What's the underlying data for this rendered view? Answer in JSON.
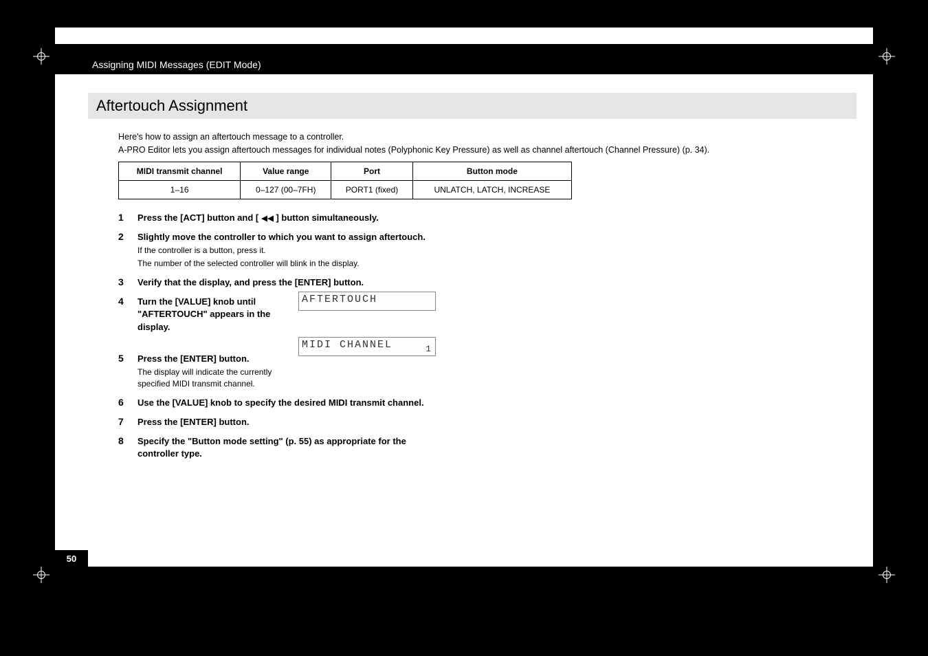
{
  "header": {
    "chapter_title": "Assigning MIDI Messages (EDIT Mode)"
  },
  "section": {
    "title": "Aftertouch Assignment"
  },
  "intro": {
    "line1": "Here's how to assign an aftertouch message to a controller.",
    "line2": "A-PRO Editor lets you assign aftertouch messages for individual notes (Polyphonic Key Pressure) as well as channel aftertouch (Channel Pressure) (p. 34)."
  },
  "table": {
    "headers": {
      "c1": "MIDI transmit channel",
      "c2": "Value range",
      "c3": "Port",
      "c4": "Button mode"
    },
    "row": {
      "c1": "1–16",
      "c2": "0–127 (00–7FH)",
      "c3": "PORT1 (fixed)",
      "c4": "UNLATCH, LATCH, INCREASE"
    }
  },
  "steps": {
    "s1": {
      "num": "1",
      "title_a": "Press the [ACT] button and [",
      "title_b": "] button simultaneously."
    },
    "s2": {
      "num": "2",
      "title": "Slightly move the controller to which you want to assign aftertouch.",
      "note1": "If the controller is a button, press it.",
      "note2": "The number of the selected controller will blink in the display."
    },
    "s3": {
      "num": "3",
      "title": "Verify that the display, and press the [ENTER] button."
    },
    "s4": {
      "num": "4",
      "title": "Turn the [VALUE] knob until \"AFTERTOUCH\" appears in the display."
    },
    "s5": {
      "num": "5",
      "title": "Press the [ENTER] button.",
      "note1": "The display will indicate the currently specified MIDI transmit channel."
    },
    "s6": {
      "num": "6",
      "title": "Use the [VALUE] knob to specify the desired MIDI transmit channel."
    },
    "s7": {
      "num": "7",
      "title": "Press the [ENTER] button."
    },
    "s8": {
      "num": "8",
      "title": "Specify the  \"Button mode setting\" (p. 55) as appropriate for the controller type."
    }
  },
  "lcd": {
    "d1": "AFTERTOUCH",
    "d2_main": "MIDI CHANNEL",
    "d2_corner": "1"
  },
  "page_number": "50"
}
